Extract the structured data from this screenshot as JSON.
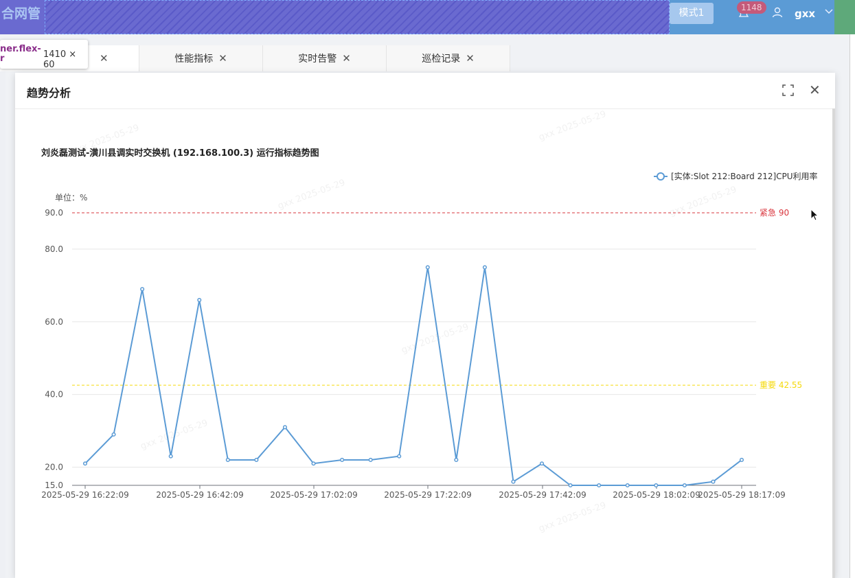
{
  "header": {
    "brand": "合网管",
    "mode_button": "模式1",
    "notification_count": "1148",
    "username": "gxx"
  },
  "inspector_tooltip": {
    "selector": "ner.flex-\nr",
    "size": "1410 × 60"
  },
  "tabs": [
    {
      "label": "",
      "active": true
    },
    {
      "label": "性能指标",
      "active": false
    },
    {
      "label": "实时告警",
      "active": false
    },
    {
      "label": "巡检记录",
      "active": false
    }
  ],
  "modal": {
    "title": "趋势分析"
  },
  "watermark": {
    "line1": "gxx",
    "line2": "2025-05-29"
  },
  "chart_data": {
    "type": "line",
    "title": "刘炎磊测试-潢川县调实时交换机 (192.168.100.3) 运行指标趋势图",
    "ylabel": "单位：%",
    "ylim": [
      15,
      90
    ],
    "yticks": [
      "15.0",
      "20.0",
      "40.0",
      "60.0",
      "80.0",
      "90.0"
    ],
    "xticks": [
      "2025-05-29 16:22:09",
      "2025-05-29 16:42:09",
      "2025-05-29 17:02:09",
      "2025-05-29 17:22:09",
      "2025-05-29 17:42:09",
      "2025-05-29 18:02:09",
      "2025-05-29 18:17:09"
    ],
    "series": [
      {
        "name": "[实体:Slot 212:Board 212]CPU利用率",
        "color": "#5b9bd5",
        "values": [
          21,
          29,
          69,
          23,
          66,
          22,
          22,
          31,
          21,
          22,
          22,
          23,
          75,
          22,
          75,
          16,
          21,
          15,
          15,
          15,
          15,
          15,
          16,
          22
        ]
      }
    ],
    "thresholds": [
      {
        "label": "紧急 90",
        "value": 90,
        "color": "#d9363e"
      },
      {
        "label": "重要 42.55",
        "value": 42.55,
        "color": "#f5d90a"
      }
    ],
    "grid": true,
    "legend_position": "top-right"
  }
}
